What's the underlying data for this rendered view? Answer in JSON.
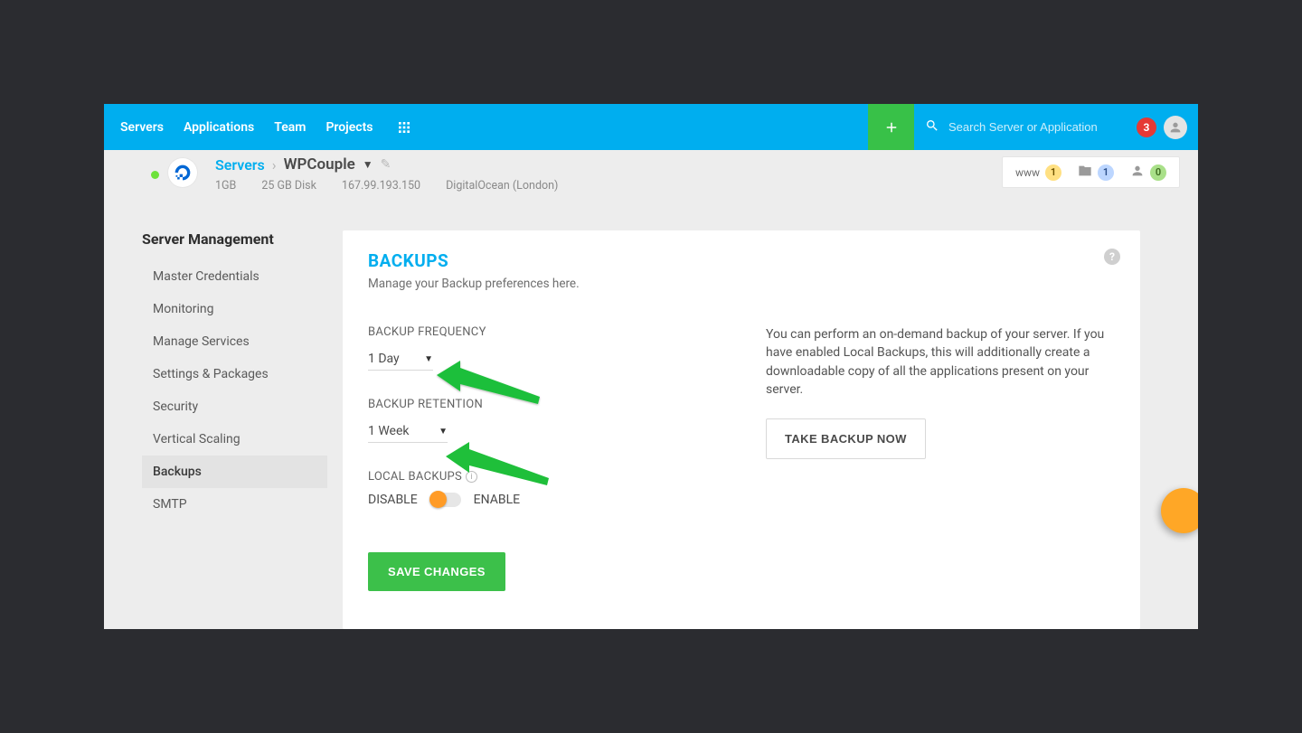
{
  "topnav": {
    "items": [
      "Servers",
      "Applications",
      "Team",
      "Projects"
    ],
    "search_placeholder": "Search Server or Application",
    "notif_count": "3"
  },
  "header": {
    "breadcrumb_root": "Servers",
    "server_name": "WPCouple",
    "ram": "1GB",
    "disk": "25 GB Disk",
    "ip": "167.99.193.150",
    "provider": "DigitalOcean (London)",
    "stats": {
      "www_label": "www",
      "www": "1",
      "apps": "1",
      "users": "0"
    }
  },
  "sidebar": {
    "title": "Server Management",
    "items": [
      "Master Credentials",
      "Monitoring",
      "Manage Services",
      "Settings & Packages",
      "Security",
      "Vertical Scaling",
      "Backups",
      "SMTP"
    ],
    "active_index": 6
  },
  "panel": {
    "title": "BACKUPS",
    "subtitle": "Manage your Backup preferences here.",
    "freq_label": "BACKUP FREQUENCY",
    "freq_value": "1 Day",
    "retention_label": "BACKUP RETENTION",
    "retention_value": "1 Week",
    "local_label": "LOCAL BACKUPS",
    "disable": "DISABLE",
    "enable": "ENABLE",
    "save_label": "SAVE CHANGES",
    "right_text": "You can perform an on-demand backup of your server. If you have enabled Local Backups, this will additionally create a downloadable copy of all the applications present on your server.",
    "backup_now_label": "TAKE BACKUP NOW"
  }
}
